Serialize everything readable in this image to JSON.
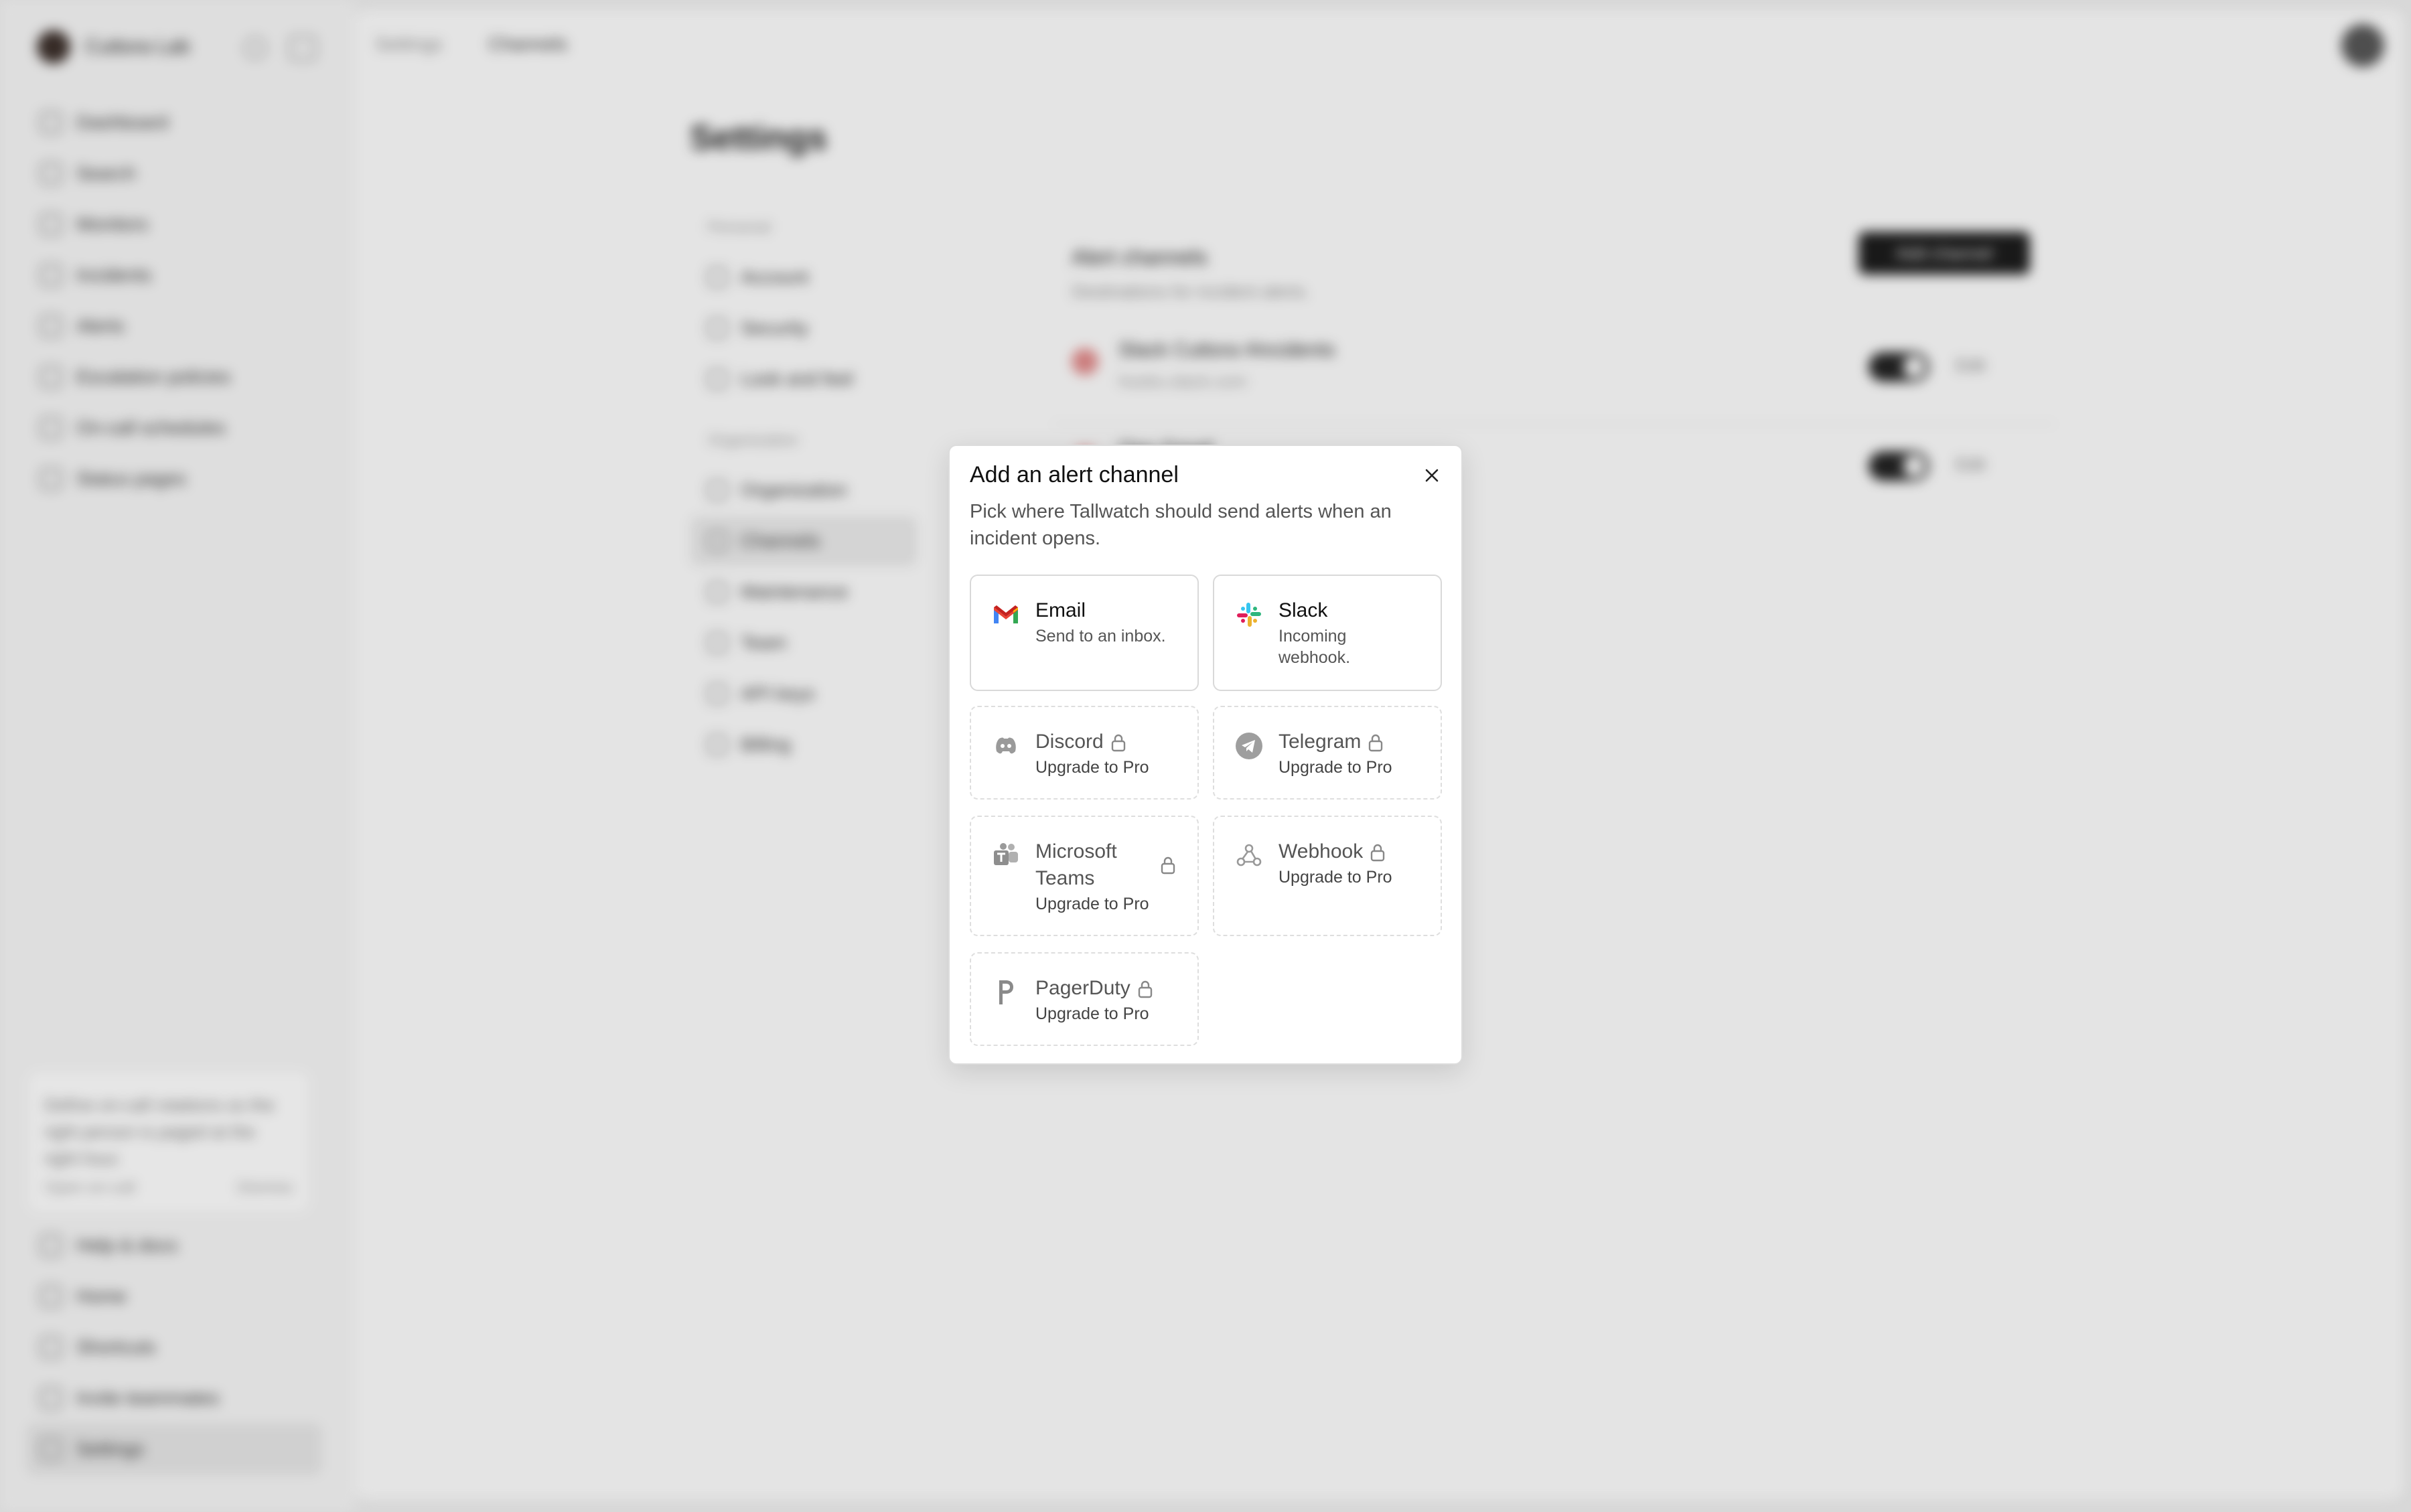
{
  "sidebar": {
    "brand": "Cuttora Lab",
    "items": [
      "Dashboard",
      "Search",
      "Monitors",
      "Incidents",
      "Alerts",
      "Escalation policies",
      "On-call schedules",
      "Status pages"
    ],
    "promo_text": "Define on-call rotations so the right person is paged at the right hour.",
    "promo_action": "Open on-call",
    "promo_dismiss": "Dismiss",
    "footer_items": [
      "Help & docs",
      "Home",
      "Shortcuts",
      "Invite teammates",
      "Settings"
    ]
  },
  "breadcrumb": {
    "parent": "Settings",
    "current": "Channels"
  },
  "page": {
    "title": "Settings"
  },
  "settings_nav": {
    "group_personal": "Personal",
    "personal": [
      "Account",
      "Security",
      "Look and feel"
    ],
    "group_org": "Organization",
    "org": [
      "Organization",
      "Channels",
      "Maintenance",
      "Team",
      "API keys",
      "Billing"
    ]
  },
  "section": {
    "title": "Alert channels",
    "subtitle": "Destinations for incident alerts.",
    "add_button": "Add channel",
    "edit_label": "Edit",
    "rows": [
      {
        "name": "Slack Cuttora #incidents",
        "url": "hooks.slack.com"
      },
      {
        "name": "Ops Gmail",
        "url": ""
      }
    ]
  },
  "modal": {
    "title": "Add an alert channel",
    "description": "Pick where Tallwatch should send alerts when an incident opens.",
    "channels": [
      {
        "name": "Email",
        "subtitle": "Send to an inbox.",
        "icon": "gmail-icon",
        "locked": false
      },
      {
        "name": "Slack",
        "subtitle": "Incoming webhook.",
        "icon": "slack-icon",
        "locked": false
      },
      {
        "name": "Discord",
        "subtitle": "Upgrade to Pro",
        "icon": "discord-icon",
        "locked": true
      },
      {
        "name": "Telegram",
        "subtitle": "Upgrade to Pro",
        "icon": "telegram-icon",
        "locked": true
      },
      {
        "name": "Microsoft Teams",
        "subtitle": "Upgrade to Pro",
        "icon": "teams-icon",
        "locked": true
      },
      {
        "name": "Webhook",
        "subtitle": "Upgrade to Pro",
        "icon": "webhook-icon",
        "locked": true
      },
      {
        "name": "PagerDuty",
        "subtitle": "Upgrade to Pro",
        "icon": "pagerduty-icon",
        "locked": true
      }
    ]
  }
}
